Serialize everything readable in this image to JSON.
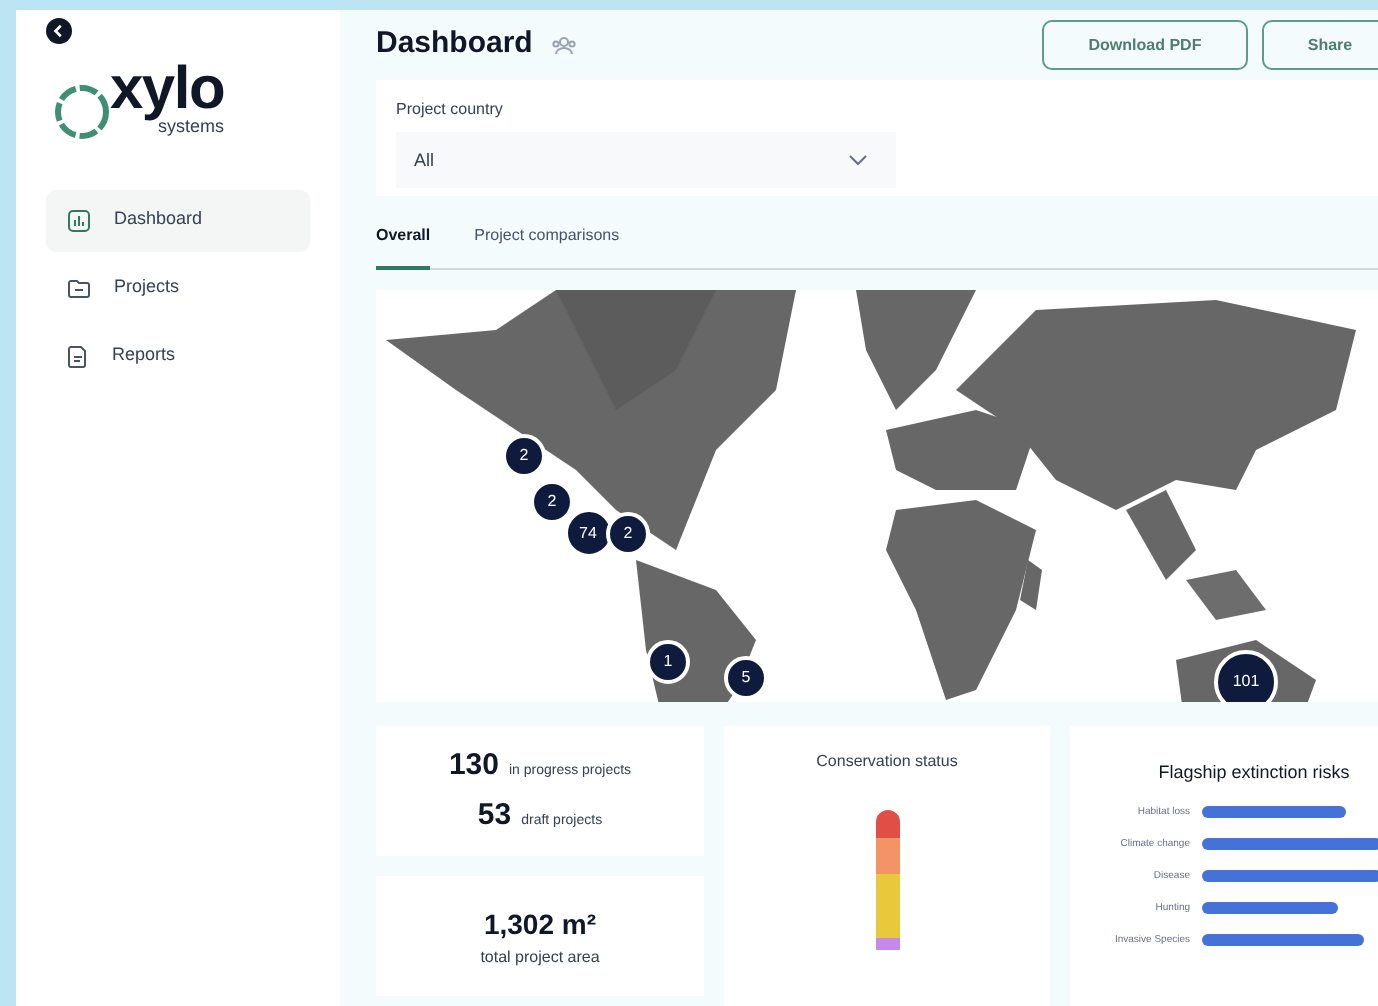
{
  "sidebar": {
    "brand": "xylo",
    "brand_sub": "systems",
    "items": [
      {
        "label": "Dashboard",
        "selected": true
      },
      {
        "label": "Projects",
        "selected": false
      },
      {
        "label": "Reports",
        "selected": false
      }
    ]
  },
  "header": {
    "title": "Dashboard",
    "buttons": [
      "Download PDF",
      "Share"
    ]
  },
  "filter": {
    "label": "Project country",
    "value": "All"
  },
  "tabs": [
    {
      "label": "Overall",
      "selected": true
    },
    {
      "label": "Project comparisons",
      "selected": false
    }
  ],
  "map": {
    "clusters": [
      "2",
      "2",
      "74",
      "2",
      "1",
      "5",
      "101"
    ]
  },
  "stats": {
    "in_progress": {
      "value": "130",
      "label": "in progress projects"
    },
    "draft": {
      "value": "53",
      "label": "draft projects"
    },
    "area": {
      "value": "1,302 m²",
      "label": "total project area"
    }
  },
  "conservation": {
    "title": "Conservation status"
  },
  "risks": {
    "title": "Flagship extinction risks",
    "rows": [
      {
        "label": "Habitat loss"
      },
      {
        "label": "Climate change"
      },
      {
        "label": "Disease"
      },
      {
        "label": "Hunting"
      },
      {
        "label": "Invasive Species"
      }
    ]
  }
}
